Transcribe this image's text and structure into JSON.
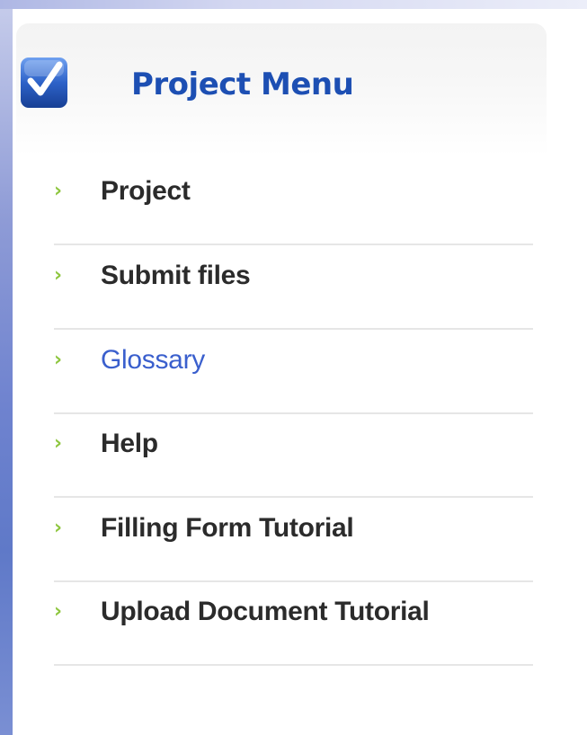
{
  "menu": {
    "title": "Project Menu",
    "title_color": "#1d4fb3",
    "bullet_color": "#8ec63f",
    "bullet_glyph": "›",
    "items": [
      {
        "label": "Project",
        "active": false
      },
      {
        "label": "Submit files",
        "active": false
      },
      {
        "label": "Glossary",
        "active": true,
        "color": "#3a5fcd"
      },
      {
        "label": "Help",
        "active": false
      },
      {
        "label": "Filling Form Tutorial",
        "active": false
      },
      {
        "label": "Upload Document Tutorial",
        "active": false
      }
    ]
  },
  "icons": {
    "header_icon": "checkbox-checked-icon"
  }
}
